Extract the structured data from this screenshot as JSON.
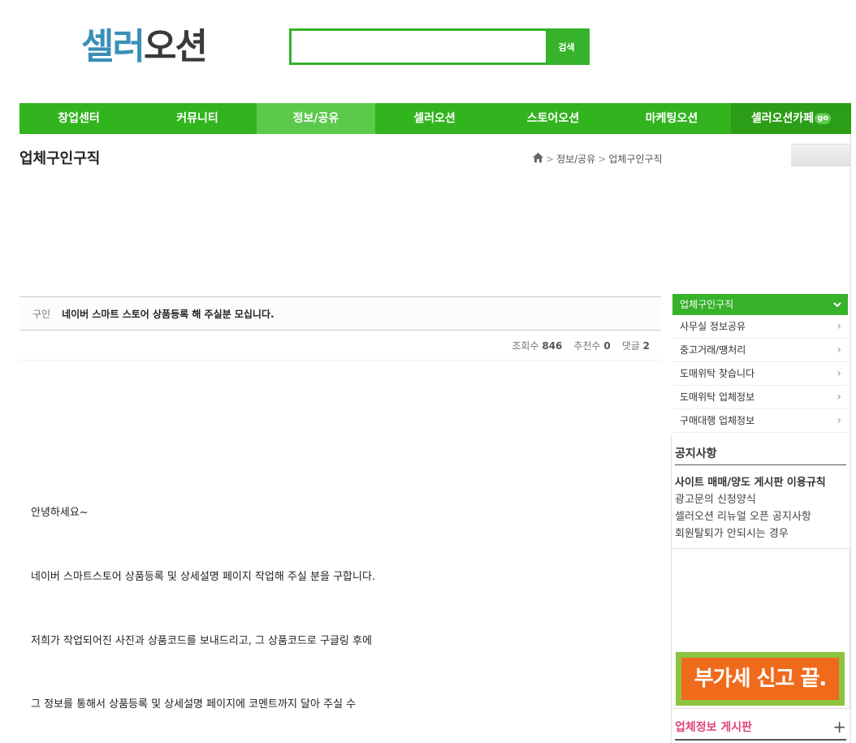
{
  "logo": {
    "part1": "셀러",
    "part2": "오션"
  },
  "search": {
    "placeholder": "",
    "button": "검색"
  },
  "nav": {
    "items": [
      "창업센터",
      "커뮤니티",
      "정보/공유",
      "셀러오션",
      "스토어오션",
      "마케팅오션"
    ],
    "last": "셀러오션카페",
    "go": "go",
    "active_index": 2
  },
  "page": {
    "title": "업체구인구직"
  },
  "breadcrumb": {
    "home_icon": "home-icon",
    "items": [
      "정보/공유",
      "업체구인구직"
    ],
    "sep": ">"
  },
  "post": {
    "category": "구인",
    "subject": "네이버 스마트 스토어 상품등록 해 주실분 모십니다.",
    "views_label": "조회수",
    "views": "846",
    "recommend_label": "추천수",
    "recommend": "0",
    "comments_label": "댓글",
    "comments": "2",
    "body": [
      "안녕하세요~",
      "네이버 스마트스토어 상품등록 및 상세설명 페이지 작업해 주실 분을 구합니다.",
      "저희가 작업되어진 사진과 상품코드를 보내드리고, 그 상품코드로 구글링 후에",
      "그 정보를 통해서 상품등록 및 상세설명 페이지에 코멘트까지 달아 주실 수"
    ]
  },
  "sidebar": {
    "menu_head": "업체구인구직",
    "menu_items": [
      "사무실 정보공유",
      "중고거래/땡처리",
      "도매위탁 찾습니다",
      "도매위탁 업체정보",
      "구매대행 업체정보"
    ],
    "notice_title": "공지사항",
    "notices": [
      "사이트 매매/양도 게시판 이용규칙",
      "광고문의 신청양식",
      "셀러오션 리뉴얼 오픈 공지사항",
      "회원탈퇴가 안되시는 경우"
    ],
    "banner_text": "부가세 신고 끝.",
    "board_title": "업체정보 게시판",
    "board_plus": "+"
  },
  "colors": {
    "brand_green": "#36b22b",
    "logo_blue": "#3a8fb7",
    "banner_orange": "#f06a1c",
    "board_pink": "#e0457b"
  }
}
